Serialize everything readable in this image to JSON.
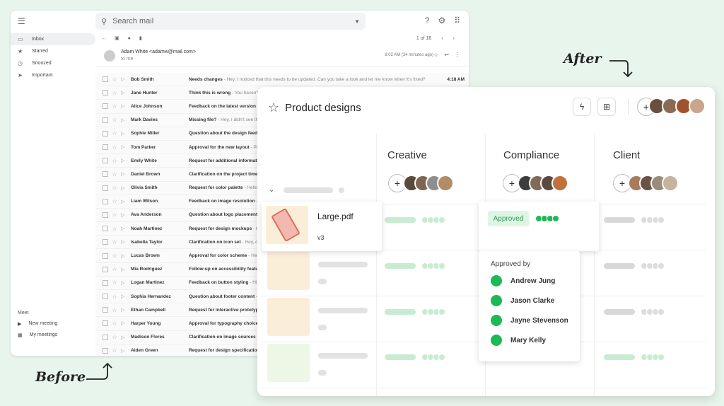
{
  "gmail": {
    "search_placeholder": "Search mail",
    "sidebar": [
      "Inbox",
      "Starred",
      "Snoozed",
      "Important"
    ],
    "meet_title": "Meet",
    "meet_items": [
      "New meeting",
      "My meetings"
    ],
    "pager": "1 of 16",
    "sender_line": "Adam White <adamw@mail.com>",
    "to_me": "to me",
    "time": "8:02 AM (34 minutes ago)",
    "rows": [
      {
        "sender": "Bob Smith",
        "subject": "Needs changes",
        "snippet": " - Hey, I noticed that this needs to be updated. Can you take a look and let me know when it's fixed?",
        "time": "4:18 AM"
      },
      {
        "sender": "Jane Hunter",
        "subject": "Think this is wrong",
        "snippet": " - You haven't",
        "time": ""
      },
      {
        "sender": "Alice Johnson",
        "subject": "Feedback on the latest version",
        "snippet": " - ",
        "time": ""
      },
      {
        "sender": "Mark Davies",
        "subject": "Missing file?",
        "snippet": " - Hey, I didn't see th",
        "time": ""
      },
      {
        "sender": "Sophie Miller",
        "subject": "Question about the design feedb",
        "snippet": "",
        "time": ""
      },
      {
        "sender": "Tom Parker",
        "subject": "Approval for the new layout",
        "snippet": " - Plea",
        "time": ""
      },
      {
        "sender": "Emily White",
        "subject": "Request for additional informatic",
        "snippet": "",
        "time": ""
      },
      {
        "sender": "Daniel Brown",
        "subject": "Clarification on the project timeli",
        "snippet": "",
        "time": ""
      },
      {
        "sender": "Olivia Smith",
        "subject": "Request for color palette",
        "snippet": " - Hello,",
        "time": ""
      },
      {
        "sender": "Liam Wilson",
        "subject": "Feedback on image resolution",
        "snippet": " - He",
        "time": ""
      },
      {
        "sender": "Ava Anderson",
        "subject": "Question about logo placement",
        "snippet": " - ",
        "time": ""
      },
      {
        "sender": "Noah Martinez",
        "subject": "Request for design mockups",
        "snippet": " - Hi,",
        "time": ""
      },
      {
        "sender": "Isabella Taylor",
        "subject": "Clarification on icon set",
        "snippet": " - Hey, c",
        "time": ""
      },
      {
        "sender": "Lucas Brown",
        "subject": "Approval for color scheme",
        "snippet": " - Hello,",
        "time": ""
      },
      {
        "sender": "Mia Rodriguez",
        "subject": "Follow-up on accessibility featur",
        "snippet": "",
        "time": ""
      },
      {
        "sender": "Logan Martinez",
        "subject": "Feedback on button styling",
        "snippet": " - Hi",
        "time": ""
      },
      {
        "sender": "Sophia Hernandez",
        "subject": "Question about footer content",
        "snippet": " - H",
        "time": ""
      },
      {
        "sender": "Ethan Campbell",
        "subject": "Request for interactive prototype",
        "snippet": "",
        "time": ""
      },
      {
        "sender": "Harper Young",
        "subject": "Approval for typography choices",
        "snippet": "",
        "time": ""
      },
      {
        "sender": "Madison Flores",
        "subject": "Clarification on image sources",
        "snippet": " - ",
        "time": ""
      },
      {
        "sender": "Aiden Green",
        "subject": "Request for design specifications",
        "snippet": "",
        "time": ""
      }
    ]
  },
  "after": {
    "title": "Product designs",
    "columns": [
      "Creative",
      "Compliance",
      "Client"
    ],
    "file_name": "Large.pdf",
    "file_version": "v3",
    "approved_label": "Approved",
    "approved_by_title": "Approved by",
    "approvers": [
      "Andrew Jung",
      "Jason Clarke",
      "Jayne Stevenson",
      "Mary Kelly"
    ]
  },
  "labels": {
    "after": "After",
    "before": "Before"
  },
  "colors": {
    "background": "#e8f5ec",
    "green": "#1db954",
    "light_green": "#c7ecd2"
  }
}
